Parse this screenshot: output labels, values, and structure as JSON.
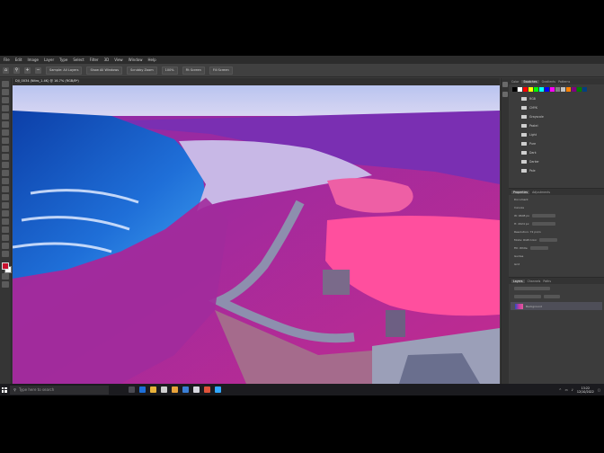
{
  "app": {
    "accent": "#31a8ff"
  },
  "menu": {
    "items": [
      "File",
      "Edit",
      "Image",
      "Layer",
      "Type",
      "Select",
      "Filter",
      "3D",
      "View",
      "Window",
      "Help"
    ]
  },
  "options": {
    "items": [
      "Sample: All Layers",
      "Show All Windows",
      "Scrubby Zoom",
      "100%",
      "Fit Screen",
      "Fill Screen"
    ]
  },
  "document": {
    "tab_title": "DJI_0034 (Nitro_1.4K) @ 16.7% (RGB/8*)"
  },
  "panels": {
    "top_tabs": [
      "Color",
      "Swatches",
      "Gradients",
      "Patterns"
    ],
    "swatch_colors": [
      "#000000",
      "#ffffff",
      "#ff0000",
      "#ffff00",
      "#00ff00",
      "#00ffff",
      "#0000ff",
      "#ff00ff",
      "#808080",
      "#c0c0c0",
      "#ff8000",
      "#800080",
      "#008000",
      "#004080"
    ],
    "swatch_folders": [
      "RGB",
      "CMYK",
      "Grayscale",
      "Pastel",
      "Light",
      "Pure",
      "Dark",
      "Darker",
      "Pale"
    ],
    "properties_tabs": [
      "Properties",
      "Adjustments"
    ],
    "properties_title": "Document",
    "properties_rows": [
      "Canvas",
      "W: 9608 px",
      "H: 2024 px",
      "Resolution: 72 px/in",
      "Mode: RGB Color",
      "Fill: White",
      "Guides",
      "Grid"
    ],
    "layers_tabs": [
      "Layers",
      "Channels",
      "Paths"
    ],
    "layer_name": "Background"
  },
  "taskbar": {
    "search_placeholder": "Type here to search",
    "tray_time": "13:22",
    "tray_date": "12/10/2022"
  }
}
